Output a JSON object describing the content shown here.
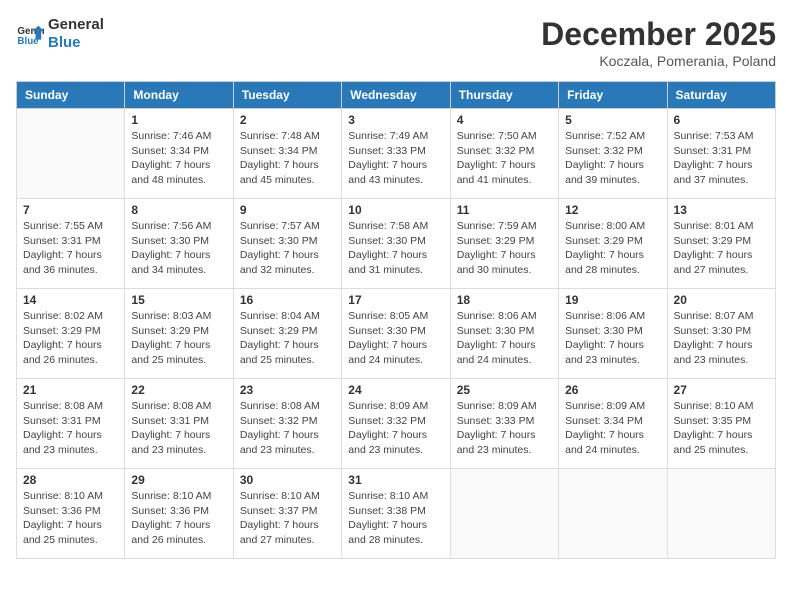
{
  "logo": {
    "line1": "General",
    "line2": "Blue"
  },
  "title": "December 2025",
  "location": "Koczala, Pomerania, Poland",
  "days_of_week": [
    "Sunday",
    "Monday",
    "Tuesday",
    "Wednesday",
    "Thursday",
    "Friday",
    "Saturday"
  ],
  "weeks": [
    [
      {
        "day": "",
        "info": ""
      },
      {
        "day": "1",
        "info": "Sunrise: 7:46 AM\nSunset: 3:34 PM\nDaylight: 7 hours\nand 48 minutes."
      },
      {
        "day": "2",
        "info": "Sunrise: 7:48 AM\nSunset: 3:34 PM\nDaylight: 7 hours\nand 45 minutes."
      },
      {
        "day": "3",
        "info": "Sunrise: 7:49 AM\nSunset: 3:33 PM\nDaylight: 7 hours\nand 43 minutes."
      },
      {
        "day": "4",
        "info": "Sunrise: 7:50 AM\nSunset: 3:32 PM\nDaylight: 7 hours\nand 41 minutes."
      },
      {
        "day": "5",
        "info": "Sunrise: 7:52 AM\nSunset: 3:32 PM\nDaylight: 7 hours\nand 39 minutes."
      },
      {
        "day": "6",
        "info": "Sunrise: 7:53 AM\nSunset: 3:31 PM\nDaylight: 7 hours\nand 37 minutes."
      }
    ],
    [
      {
        "day": "7",
        "info": "Sunrise: 7:55 AM\nSunset: 3:31 PM\nDaylight: 7 hours\nand 36 minutes."
      },
      {
        "day": "8",
        "info": "Sunrise: 7:56 AM\nSunset: 3:30 PM\nDaylight: 7 hours\nand 34 minutes."
      },
      {
        "day": "9",
        "info": "Sunrise: 7:57 AM\nSunset: 3:30 PM\nDaylight: 7 hours\nand 32 minutes."
      },
      {
        "day": "10",
        "info": "Sunrise: 7:58 AM\nSunset: 3:30 PM\nDaylight: 7 hours\nand 31 minutes."
      },
      {
        "day": "11",
        "info": "Sunrise: 7:59 AM\nSunset: 3:29 PM\nDaylight: 7 hours\nand 30 minutes."
      },
      {
        "day": "12",
        "info": "Sunrise: 8:00 AM\nSunset: 3:29 PM\nDaylight: 7 hours\nand 28 minutes."
      },
      {
        "day": "13",
        "info": "Sunrise: 8:01 AM\nSunset: 3:29 PM\nDaylight: 7 hours\nand 27 minutes."
      }
    ],
    [
      {
        "day": "14",
        "info": "Sunrise: 8:02 AM\nSunset: 3:29 PM\nDaylight: 7 hours\nand 26 minutes."
      },
      {
        "day": "15",
        "info": "Sunrise: 8:03 AM\nSunset: 3:29 PM\nDaylight: 7 hours\nand 25 minutes."
      },
      {
        "day": "16",
        "info": "Sunrise: 8:04 AM\nSunset: 3:29 PM\nDaylight: 7 hours\nand 25 minutes."
      },
      {
        "day": "17",
        "info": "Sunrise: 8:05 AM\nSunset: 3:30 PM\nDaylight: 7 hours\nand 24 minutes."
      },
      {
        "day": "18",
        "info": "Sunrise: 8:06 AM\nSunset: 3:30 PM\nDaylight: 7 hours\nand 24 minutes."
      },
      {
        "day": "19",
        "info": "Sunrise: 8:06 AM\nSunset: 3:30 PM\nDaylight: 7 hours\nand 23 minutes."
      },
      {
        "day": "20",
        "info": "Sunrise: 8:07 AM\nSunset: 3:30 PM\nDaylight: 7 hours\nand 23 minutes."
      }
    ],
    [
      {
        "day": "21",
        "info": "Sunrise: 8:08 AM\nSunset: 3:31 PM\nDaylight: 7 hours\nand 23 minutes."
      },
      {
        "day": "22",
        "info": "Sunrise: 8:08 AM\nSunset: 3:31 PM\nDaylight: 7 hours\nand 23 minutes."
      },
      {
        "day": "23",
        "info": "Sunrise: 8:08 AM\nSunset: 3:32 PM\nDaylight: 7 hours\nand 23 minutes."
      },
      {
        "day": "24",
        "info": "Sunrise: 8:09 AM\nSunset: 3:32 PM\nDaylight: 7 hours\nand 23 minutes."
      },
      {
        "day": "25",
        "info": "Sunrise: 8:09 AM\nSunset: 3:33 PM\nDaylight: 7 hours\nand 23 minutes."
      },
      {
        "day": "26",
        "info": "Sunrise: 8:09 AM\nSunset: 3:34 PM\nDaylight: 7 hours\nand 24 minutes."
      },
      {
        "day": "27",
        "info": "Sunrise: 8:10 AM\nSunset: 3:35 PM\nDaylight: 7 hours\nand 25 minutes."
      }
    ],
    [
      {
        "day": "28",
        "info": "Sunrise: 8:10 AM\nSunset: 3:36 PM\nDaylight: 7 hours\nand 25 minutes."
      },
      {
        "day": "29",
        "info": "Sunrise: 8:10 AM\nSunset: 3:36 PM\nDaylight: 7 hours\nand 26 minutes."
      },
      {
        "day": "30",
        "info": "Sunrise: 8:10 AM\nSunset: 3:37 PM\nDaylight: 7 hours\nand 27 minutes."
      },
      {
        "day": "31",
        "info": "Sunrise: 8:10 AM\nSunset: 3:38 PM\nDaylight: 7 hours\nand 28 minutes."
      },
      {
        "day": "",
        "info": ""
      },
      {
        "day": "",
        "info": ""
      },
      {
        "day": "",
        "info": ""
      }
    ]
  ]
}
